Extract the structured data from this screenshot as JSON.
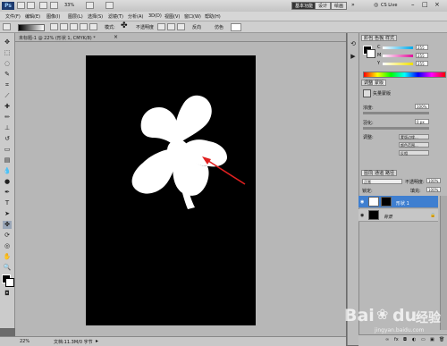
{
  "app": {
    "logo": "Ps",
    "zoom": "33%",
    "workspace_buttons": [
      "基本功能",
      "设计",
      "绘画"
    ],
    "cs_live": "CS Live"
  },
  "menu": [
    "文件(F)",
    "编辑(E)",
    "图像(I)",
    "图层(L)",
    "选择(S)",
    "滤镜(T)",
    "分析(A)",
    "3D(D)",
    "视图(V)",
    "窗口(W)",
    "帮助(H)"
  ],
  "options": {
    "mode_label": "模式:",
    "opacity_label": "不透明度",
    "reverse_label": "反向",
    "dither_label": "仿色",
    "transparency_label": "透明区域"
  },
  "document": {
    "tab_title": "未标题-1 @ 22% (形状 1, CMYK/8) *",
    "status_zoom": "22%",
    "status_doc": "文档:11.3M/0 字节"
  },
  "color_panel": {
    "tabs": [
      "颜色",
      "色板",
      "样式"
    ],
    "rows": [
      {
        "label": "C",
        "value": "255"
      },
      {
        "label": "M",
        "value": "255"
      },
      {
        "label": "Y",
        "value": "255"
      }
    ]
  },
  "adjust_panel": {
    "tabs": [
      "调整",
      "蒙版"
    ],
    "layer_type": "矢量蒙版",
    "density_label": "浓度:",
    "density_value": "100%",
    "feather_label": "羽化:",
    "feather_value": "0 px",
    "refine_label": "调整:",
    "buttons": [
      "蒙版边缘...",
      "颜色范围...",
      "反相"
    ]
  },
  "layers_panel": {
    "tabs": [
      "图层",
      "通道",
      "路径"
    ],
    "blend_mode": "正常",
    "opacity_label": "不透明度:",
    "opacity_value": "100%",
    "lock_label": "锁定:",
    "fill_label": "填充:",
    "fill_value": "100%",
    "layers": [
      {
        "name": "形状 1",
        "selected": true
      },
      {
        "name": "背景",
        "selected": false
      }
    ]
  },
  "watermark": {
    "brand": "Bai",
    "brand2": "du",
    "suffix": "经验",
    "url": "jingyan.baidu.com"
  },
  "colors": {
    "accent_selected": "#3f7fd0",
    "arrow": "#e02020"
  }
}
